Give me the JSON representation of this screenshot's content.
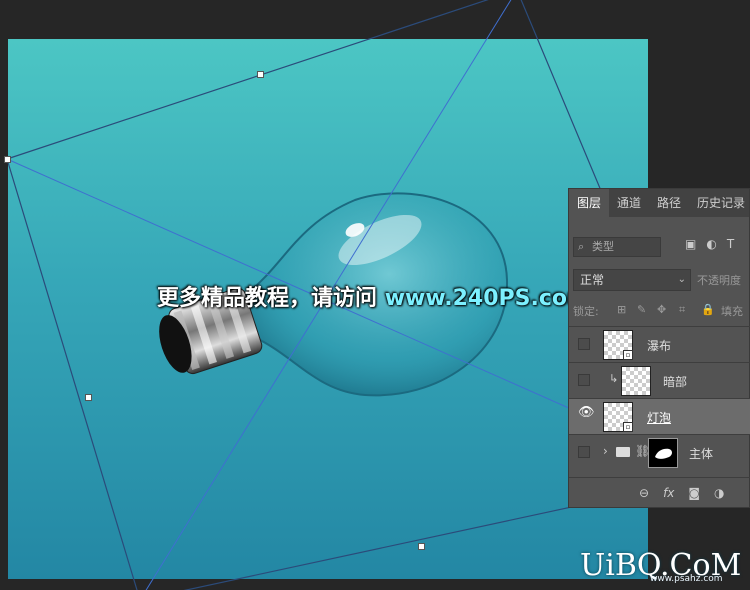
{
  "panel": {
    "tabs": [
      "图层",
      "通道",
      "路径",
      "历史记录"
    ],
    "active_tab": "图层",
    "filter_kind_placeholder": "类型",
    "blend_mode": "正常",
    "opacity_label": "不透明度",
    "lock_label": "锁定:",
    "fill_label": "填充"
  },
  "layers": [
    {
      "name": "瀑布",
      "visible": false,
      "selected": false,
      "type": "smart-object"
    },
    {
      "name": "暗部",
      "visible": false,
      "selected": false,
      "type": "clipped"
    },
    {
      "name": "灯泡",
      "visible": true,
      "selected": true,
      "type": "smart-object"
    },
    {
      "name": "主体",
      "visible": false,
      "selected": false,
      "type": "group"
    }
  ],
  "bottom_icons": [
    "link-layers-icon",
    "fx-icon",
    "add-mask-icon",
    "adjustment-icon"
  ],
  "watermark": {
    "text": "更多精品教程，请访问",
    "url": "www.240PS.com"
  },
  "site_logo": {
    "text": "UiBQ.CoM",
    "url": "www.psahz.com"
  },
  "colors": {
    "canvas_top": "#4cc6c4",
    "canvas_bottom": "#2387a4",
    "panel_bg": "#535353",
    "workspace_bg": "#262626"
  }
}
